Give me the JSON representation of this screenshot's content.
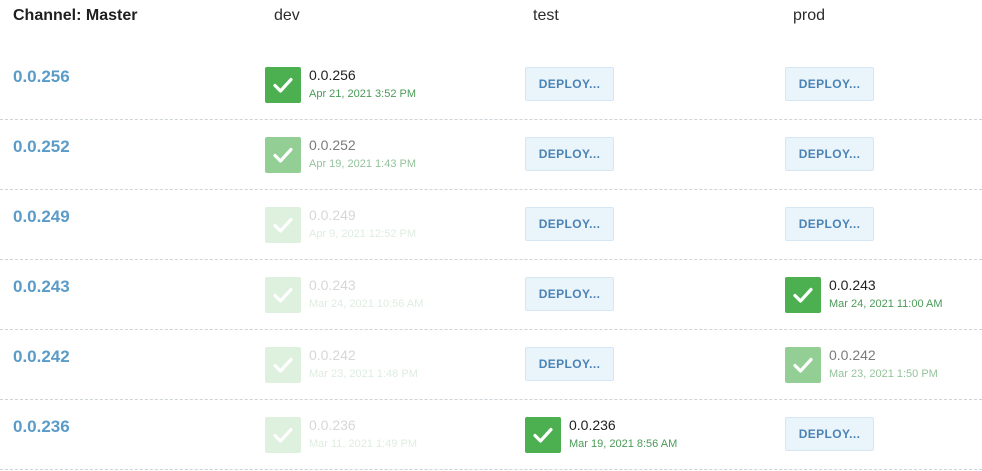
{
  "header": {
    "channel": "Channel: Master",
    "environments": [
      "dev",
      "test",
      "prod"
    ]
  },
  "colors": {
    "version_link": "#5a9bc8",
    "success": "#4caf50",
    "deploy_button_bg": "#eaf4fb",
    "deploy_button_text": "#4a83b4",
    "timestamp": "#4a9b57"
  },
  "deploy_label": "DEPLOY...",
  "rows": [
    {
      "version": "0.0.256",
      "dev": {
        "state": "deployed",
        "version": "0.0.256",
        "time": "Apr 21, 2021 3:52 PM",
        "emphasis": "current"
      },
      "test": {
        "state": "deploy"
      },
      "prod": {
        "state": "deploy"
      }
    },
    {
      "version": "0.0.252",
      "dev": {
        "state": "deployed",
        "version": "0.0.252",
        "time": "Apr 19, 2021 1:43 PM",
        "emphasis": "previous"
      },
      "test": {
        "state": "deploy"
      },
      "prod": {
        "state": "deploy"
      }
    },
    {
      "version": "0.0.249",
      "dev": {
        "state": "deployed",
        "version": "0.0.249",
        "time": "Apr 9, 2021 12:52 PM",
        "emphasis": "history"
      },
      "test": {
        "state": "deploy"
      },
      "prod": {
        "state": "deploy"
      }
    },
    {
      "version": "0.0.243",
      "dev": {
        "state": "deployed",
        "version": "0.0.243",
        "time": "Mar 24, 2021 10:56 AM",
        "emphasis": "history"
      },
      "test": {
        "state": "deploy"
      },
      "prod": {
        "state": "deployed",
        "version": "0.0.243",
        "time": "Mar 24, 2021 11:00 AM",
        "emphasis": "current"
      }
    },
    {
      "version": "0.0.242",
      "dev": {
        "state": "deployed",
        "version": "0.0.242",
        "time": "Mar 23, 2021 1:48 PM",
        "emphasis": "history"
      },
      "test": {
        "state": "deploy"
      },
      "prod": {
        "state": "deployed",
        "version": "0.0.242",
        "time": "Mar 23, 2021 1:50 PM",
        "emphasis": "previous"
      }
    },
    {
      "version": "0.0.236",
      "dev": {
        "state": "deployed",
        "version": "0.0.236",
        "time": "Mar 11, 2021 1:49 PM",
        "emphasis": "history"
      },
      "test": {
        "state": "deployed",
        "version": "0.0.236",
        "time": "Mar 19, 2021 8:56 AM",
        "emphasis": "current"
      },
      "prod": {
        "state": "deploy"
      }
    }
  ]
}
